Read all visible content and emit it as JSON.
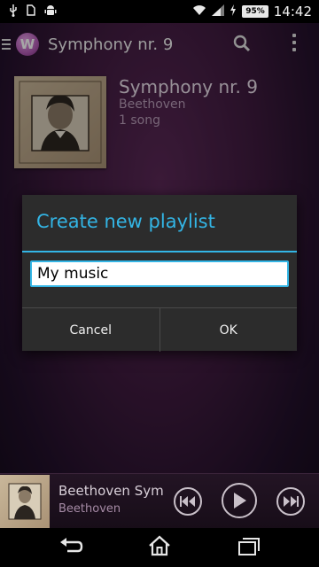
{
  "status_bar": {
    "battery": "95%",
    "time": "14:42",
    "icons": [
      "usb-icon",
      "sim-icon",
      "android-debug-icon",
      "wifi-icon",
      "signal-icon",
      "charging-icon"
    ]
  },
  "action_bar": {
    "title": "Symphony nr. 9",
    "icons": [
      "drawer-icon",
      "walkman-logo-icon",
      "search-icon",
      "overflow-menu-icon"
    ]
  },
  "album": {
    "title": "Symphony nr. 9",
    "artist": "Beethoven",
    "song_count": "1 song",
    "art_icon": "album-art-beethoven"
  },
  "dialog": {
    "title": "Create new playlist",
    "input_value": "My music",
    "cancel_label": "Cancel",
    "ok_label": "OK"
  },
  "mini_player": {
    "title": "Beethoven Symp",
    "artist": "Beethoven",
    "icons": [
      "previous-icon",
      "play-icon",
      "next-icon"
    ]
  },
  "nav_bar": {
    "icons": [
      "back-icon",
      "home-icon",
      "recent-apps-icon"
    ]
  },
  "colors": {
    "accent": "#33b5e5",
    "background": "#3d1a3d"
  }
}
